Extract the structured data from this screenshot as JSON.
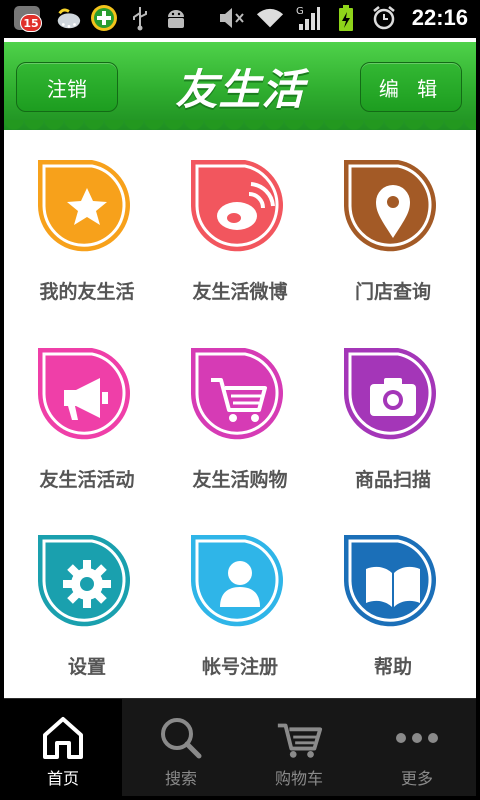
{
  "status_bar": {
    "notification_count": "15",
    "time": "22:16",
    "icons": [
      "notification-icon",
      "weather-icon",
      "plus-app-icon",
      "usb-icon",
      "android-icon",
      "mute-icon",
      "wifi-icon",
      "signal-icon",
      "battery-charging-icon",
      "alarm-icon"
    ]
  },
  "header": {
    "left_button": "注销",
    "logo": "友生活",
    "right_button": "编 辑"
  },
  "grid": [
    {
      "label": "我的友生活",
      "icon": "star-icon",
      "color": "#f7a11b"
    },
    {
      "label": "友生活微博",
      "icon": "weibo-icon",
      "color": "#f2565e"
    },
    {
      "label": "门店查询",
      "icon": "location-pin-icon",
      "color": "#a35a26"
    },
    {
      "label": "友生活活动",
      "icon": "megaphone-icon",
      "color": "#ef3fa8"
    },
    {
      "label": "友生活购物",
      "icon": "shopping-cart-icon",
      "color": "#d63bb5"
    },
    {
      "label": "商品扫描",
      "icon": "camera-icon",
      "color": "#a436b8"
    },
    {
      "label": "设置",
      "icon": "gear-icon",
      "color": "#1aa0ae"
    },
    {
      "label": "帐号注册",
      "icon": "user-icon",
      "color": "#2fb5e8"
    },
    {
      "label": "帮助",
      "icon": "book-icon",
      "color": "#1b6fb8"
    }
  ],
  "tabs": [
    {
      "label": "首页",
      "icon": "home-icon",
      "active": true
    },
    {
      "label": "搜索",
      "icon": "search-icon",
      "active": false
    },
    {
      "label": "购物车",
      "icon": "cart-icon",
      "active": false
    },
    {
      "label": "更多",
      "icon": "more-icon",
      "active": false
    }
  ]
}
